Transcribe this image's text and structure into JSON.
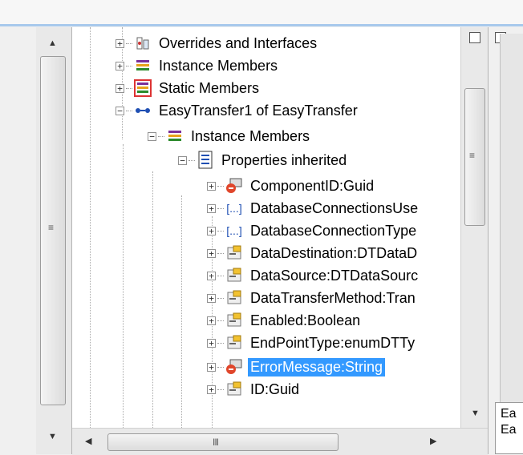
{
  "tree": {
    "items": [
      {
        "label": "Overrides and Interfaces",
        "icon": "overrides-icon",
        "expander": "+"
      },
      {
        "label": "Instance Members",
        "icon": "instance-members-icon",
        "expander": "+"
      },
      {
        "label": "Static Members",
        "icon": "static-members-icon",
        "expander": "+"
      },
      {
        "label": "EasyTransfer1 of EasyTransfer",
        "icon": "object-link-icon",
        "expander": "−"
      },
      {
        "label": "Instance Members",
        "icon": "instance-members-icon",
        "expander": "−"
      },
      {
        "label": "Properties inherited",
        "icon": "properties-page-icon",
        "expander": "−"
      },
      {
        "label": "ComponentID:Guid",
        "icon": "property-locked-icon",
        "expander": "+"
      },
      {
        "label": "DatabaseConnectionsUse",
        "icon": "bracket-field-icon",
        "expander": "+"
      },
      {
        "label": "DatabaseConnectionType",
        "icon": "bracket-field-icon",
        "expander": "+"
      },
      {
        "label": "DataDestination:DTDataD",
        "icon": "property-icon",
        "expander": "+"
      },
      {
        "label": "DataSource:DTDataSourc",
        "icon": "property-icon",
        "expander": "+"
      },
      {
        "label": "DataTransferMethod:Tran",
        "icon": "property-icon",
        "expander": "+"
      },
      {
        "label": "Enabled:Boolean",
        "icon": "property-icon",
        "expander": "+"
      },
      {
        "label": "EndPointType:enumDTTy",
        "icon": "property-icon",
        "expander": "+"
      },
      {
        "label": "ErrorMessage:String",
        "icon": "property-locked-icon",
        "expander": "+",
        "selected": true
      },
      {
        "label": "ID:Guid",
        "icon": "property-icon",
        "expander": "+"
      }
    ]
  },
  "right_panel": {
    "line1": "Ea",
    "line2": "Ea"
  },
  "scrollbars": {
    "grip_vertical": "≡",
    "grip_horizontal": "III"
  },
  "colors": {
    "selection": "#3399ff",
    "accent_line": "#a8c9ec"
  }
}
